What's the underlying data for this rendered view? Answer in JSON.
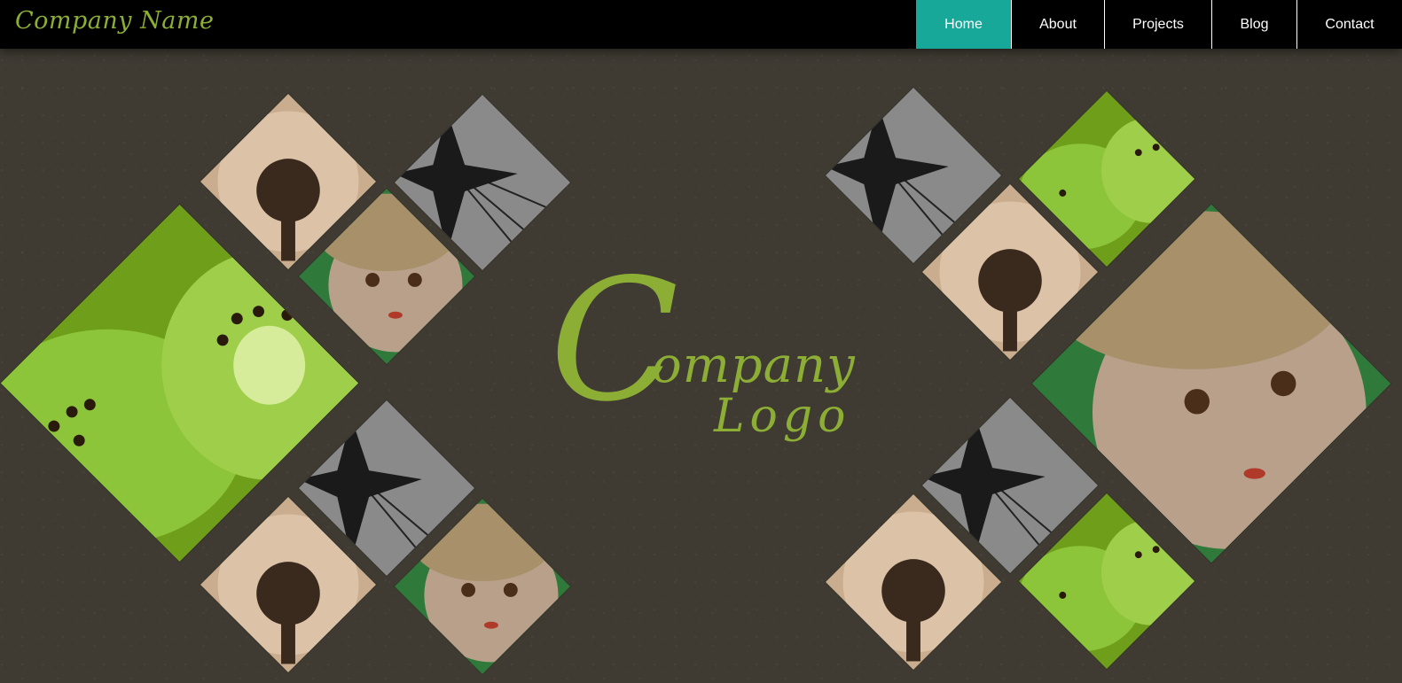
{
  "header": {
    "brand": "Company Name",
    "nav": [
      {
        "label": "Home",
        "active": true
      },
      {
        "label": "About",
        "active": false
      },
      {
        "label": "Projects",
        "active": false
      },
      {
        "label": "Blog",
        "active": false
      },
      {
        "label": "Contact",
        "active": false
      }
    ]
  },
  "hero": {
    "logo_initial": "C",
    "logo_word1": "ompany",
    "logo_word2": "Logo"
  },
  "colors": {
    "background": "#3f3b33",
    "accent_green": "#8cae35",
    "nav_active": "#17a89a",
    "header_bg": "#000000"
  },
  "tile_images": [
    "dandelion",
    "carousel-ride",
    "doll",
    "kiwi"
  ]
}
